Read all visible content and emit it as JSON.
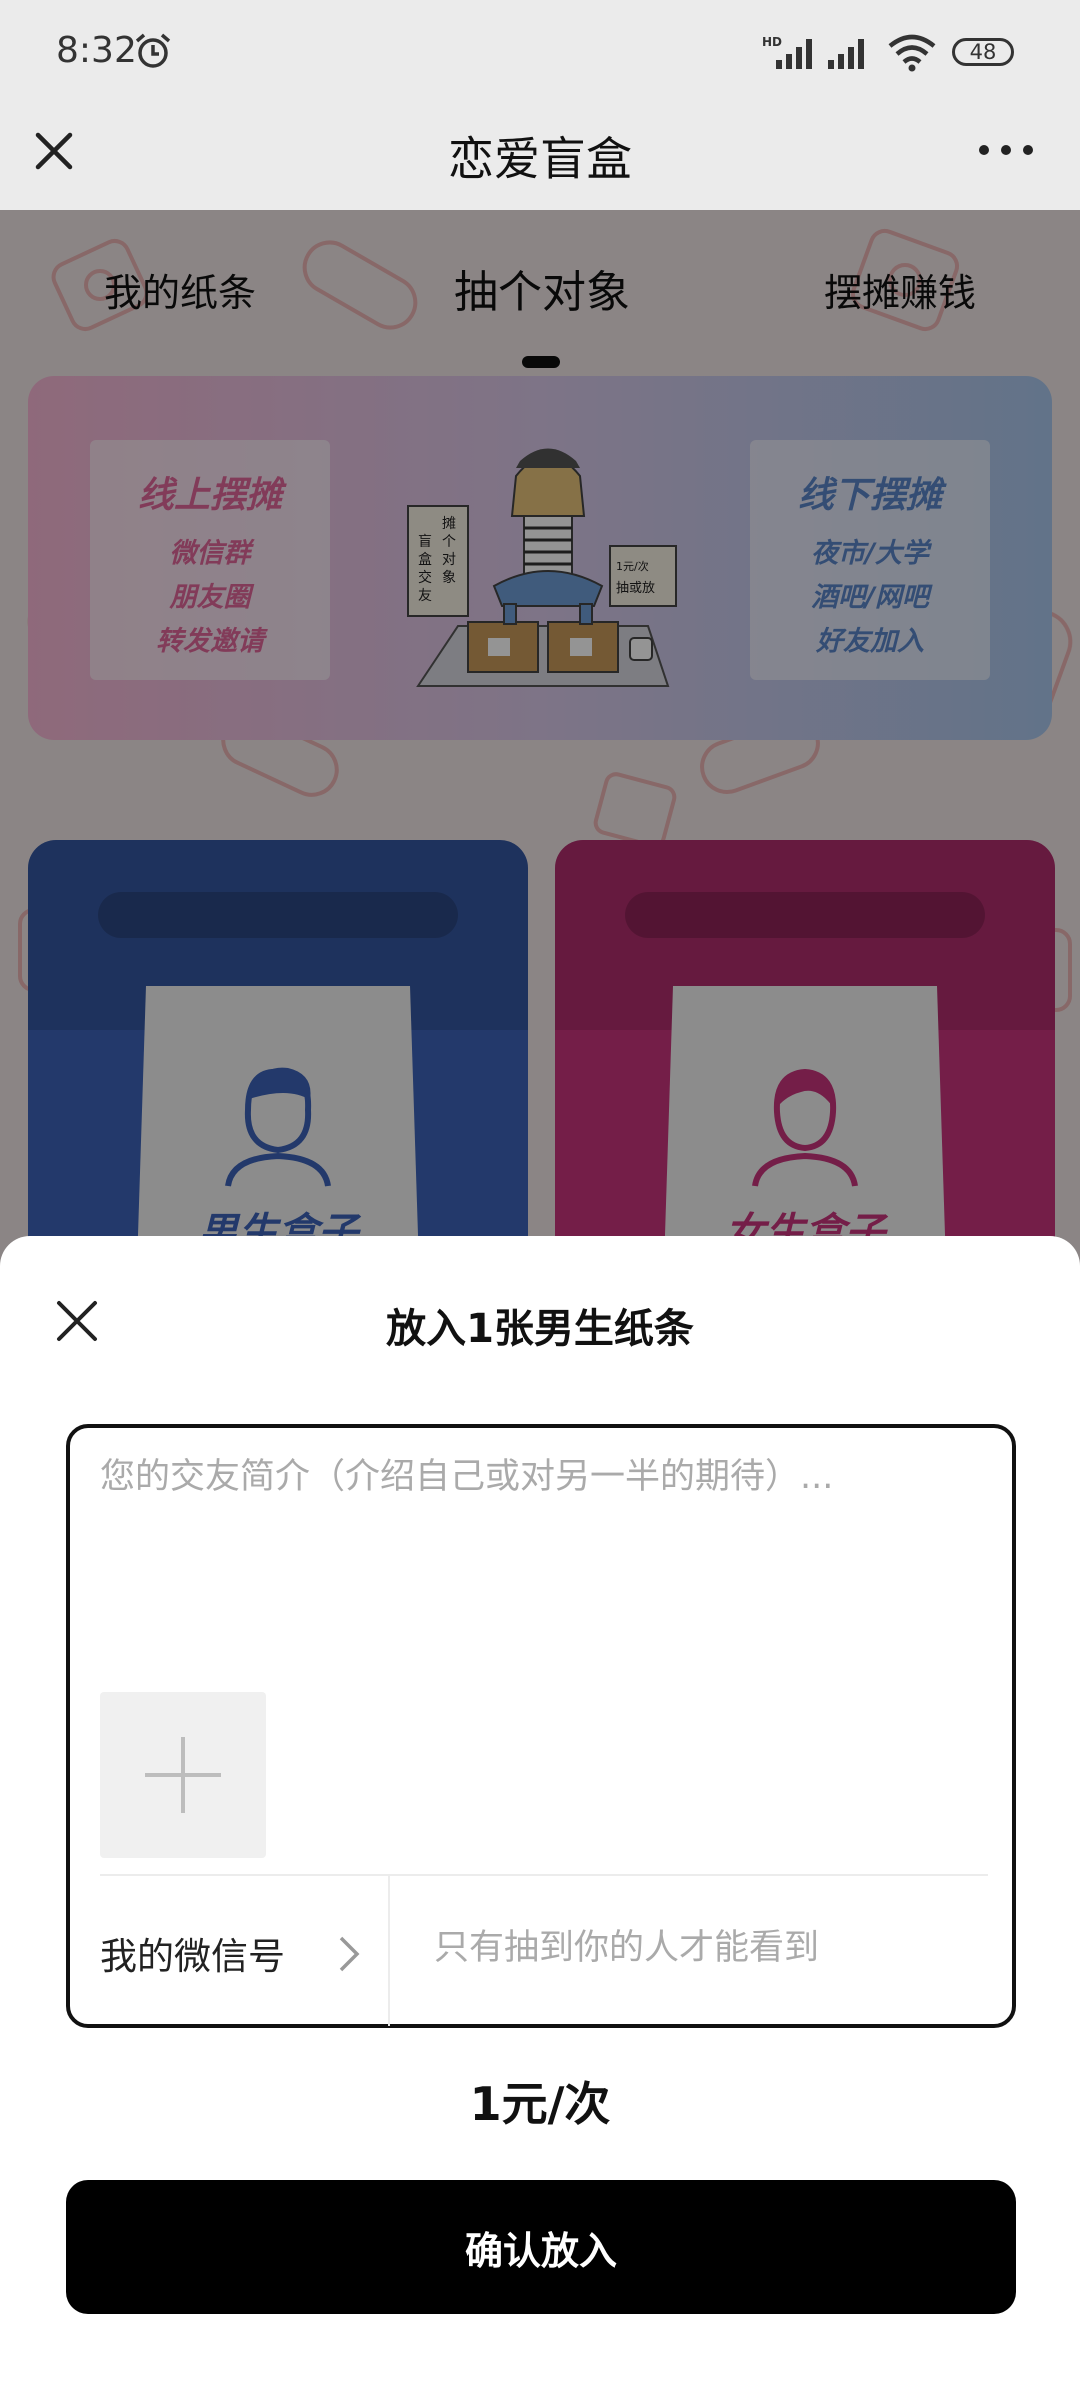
{
  "status_bar": {
    "time": "8:32",
    "battery": "48",
    "icons": [
      "alarm-icon",
      "hd-signal-icon",
      "signal-icon",
      "wifi-icon",
      "battery-icon"
    ]
  },
  "title_bar": {
    "title": "恋爱盲盒",
    "icons": [
      "close-icon",
      "more-icon"
    ]
  },
  "tabs": [
    {
      "label": "我的纸条",
      "active": false
    },
    {
      "label": "抽个对象",
      "active": true
    },
    {
      "label": "摆摊赚钱",
      "active": false
    }
  ],
  "banner": {
    "left": {
      "title": "线上摆摊",
      "lines": [
        "微信群",
        "朋友圈",
        "转发邀请"
      ]
    },
    "right": {
      "title": "线下摆摊",
      "lines": [
        "夜市/大学",
        "酒吧/网吧",
        "好友加入"
      ]
    },
    "sign_left": [
      "盲",
      "盒",
      "交",
      "友",
      "摊",
      "个",
      "对",
      "象"
    ],
    "sign_right": [
      "1元/次",
      "抽或放"
    ]
  },
  "boxes": {
    "male": {
      "label": "男生盒子",
      "color": "#3d63b8"
    },
    "female": {
      "label": "女生盒子",
      "color": "#c9347d"
    }
  },
  "sheet": {
    "title": "放入1张男生纸条",
    "intro_placeholder": "您的交友简介（介绍自己或对另一半的期待）...",
    "wechat_label": "我的微信号",
    "wechat_placeholder": "只有抽到你的人才能看到",
    "price": "1元/次",
    "confirm_label": "确认放入"
  }
}
